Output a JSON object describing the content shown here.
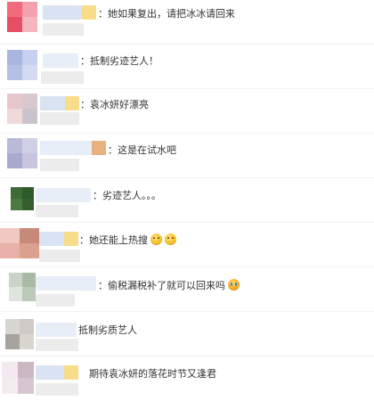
{
  "comments": [
    {
      "text": "：她如果复出，请把冰冰请回来"
    },
    {
      "text": "：抵制劣迹艺人！"
    },
    {
      "text": "：袁冰妍好漂亮"
    },
    {
      "text": "：这是在试水吧"
    },
    {
      "text": "：劣迹艺人。。。"
    },
    {
      "text": "：她还能上热搜",
      "emojis": [
        "thinking-face-icon",
        "thinking-face-icon"
      ]
    },
    {
      "text": "：偷税漏税补了就可以回来吗",
      "emojis": [
        "crying-face-icon"
      ]
    },
    {
      "text": "抵制劣质艺人"
    },
    {
      "text": "期待袁冰妍的落花时节又逢君"
    }
  ],
  "colors": {
    "avatar_1": [
      "#f06a7c",
      "#f3a2ad",
      "#e84d66",
      "#f4b6bf"
    ],
    "avatar_2": [
      "#a9b6e0",
      "#c7d0ec",
      "#b5c0e6",
      "#d3daf1"
    ],
    "avatar_3": [
      "#e7c7c9",
      "#d8c8d0",
      "#efd9da",
      "#c9c4cc"
    ],
    "avatar_4": [
      "#b9b9d8",
      "#cfcfe6",
      "#a9a9cf",
      "#c9c5e0"
    ],
    "avatar_5": [
      "#3c6b35",
      "#2f5a2a",
      "#4a7a40",
      "#365f2f"
    ],
    "avatar_6": [
      "#f1c9c2",
      "#c88a78",
      "#e8b2a8",
      "#dca08f"
    ],
    "avatar_7": [
      "#c9d3c7",
      "#aab9a6",
      "#dfe5de",
      "#bcc8b9"
    ],
    "avatar_8": [
      "#d8d6d2",
      "#cfcac4",
      "#a7a39e",
      "#d9d5cf"
    ],
    "avatar_9": [
      "#f3e9ee",
      "#cbb7c2",
      "#f5ecef",
      "#d7c6cf"
    ],
    "username_blur": "#d9e3f3",
    "username_blur_light": "#e8eef8",
    "badge_yellow": "#f7dc8a",
    "badge_orange": "#e9b080",
    "subline_blur": "#ececec"
  }
}
